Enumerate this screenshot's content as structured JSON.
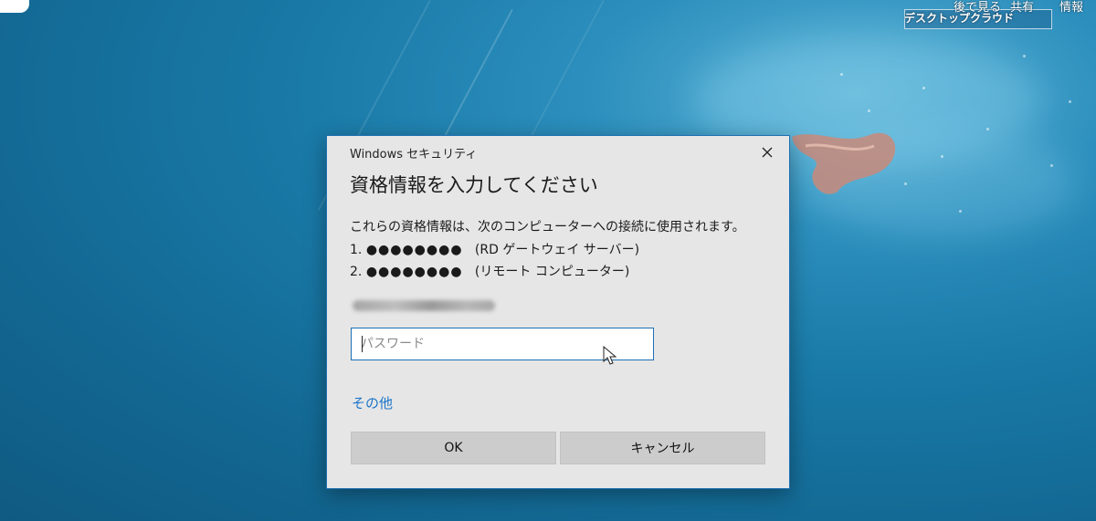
{
  "overlay": {
    "corner_text_1": "後で見る",
    "corner_text_2": "共有",
    "corner_text_3": "情報",
    "brand_text": "デスクトップクラウド"
  },
  "dialog": {
    "window_title": "Windows セキュリティ",
    "heading": "資格情報を入力してください",
    "description": "これらの資格情報は、次のコンピューターへの接続に使用されます。",
    "servers": [
      {
        "index": "1.",
        "masked_name": "●●●●●●●●",
        "role": "(RD ゲートウェイ サーバー)"
      },
      {
        "index": "2.",
        "masked_name": "●●●●●●●●",
        "role": "(リモート コンピューター)"
      }
    ],
    "password_placeholder": "パスワード",
    "other_link": "その他",
    "ok_label": "OK",
    "cancel_label": "キャンセル"
  },
  "colors": {
    "dialog_bg": "#e6e6e6",
    "accent_border": "#1f6fb2",
    "link": "#1a73c8",
    "button_bg": "#cccccc"
  }
}
